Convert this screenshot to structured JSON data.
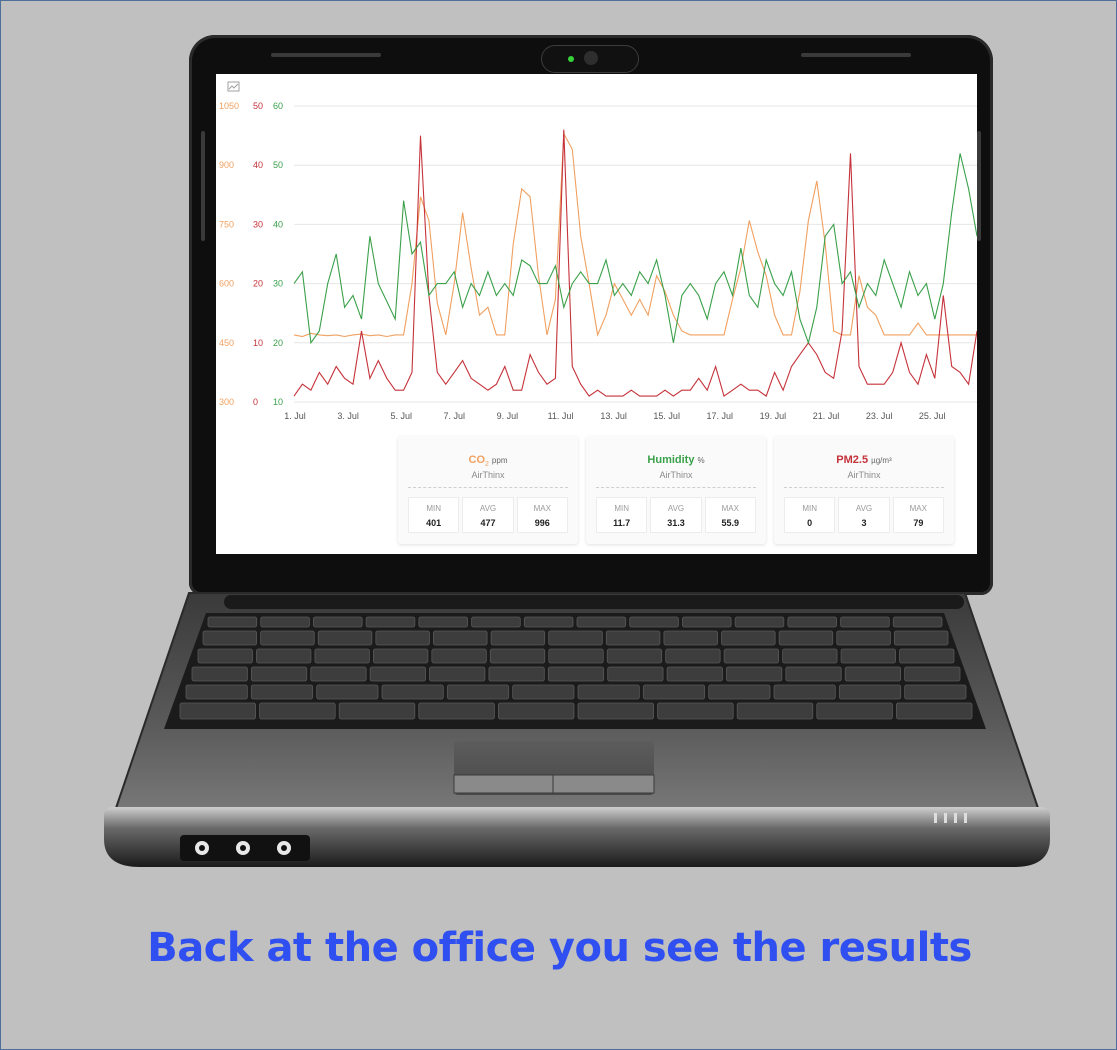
{
  "headline": "Back at the office you see the results",
  "chart_data": {
    "type": "line",
    "x_labels": [
      "1. Jul",
      "3. Jul",
      "5. Jul",
      "7. Jul",
      "9. Jul",
      "11. Jul",
      "13. Jul",
      "15. Jul",
      "17. Jul",
      "19. Jul",
      "21. Jul",
      "23. Jul",
      "25. Jul"
    ],
    "axes": [
      {
        "name": "co2",
        "color": "#f0a060",
        "ticks": [
          1050,
          900,
          750,
          600,
          450,
          300
        ]
      },
      {
        "name": "pm25",
        "color": "#c5323a",
        "ticks": [
          50,
          40,
          30,
          20,
          10,
          0
        ]
      },
      {
        "name": "humidity",
        "color": "#3aa04a",
        "ticks": [
          60,
          50,
          40,
          30,
          20,
          10
        ]
      }
    ],
    "series": [
      {
        "color": "#f0a060",
        "values": [
          470,
          466,
          474,
          470,
          468,
          470,
          466,
          470,
          472,
          468,
          470,
          466,
          470,
          470,
          600,
          820,
          760,
          550,
          470,
          600,
          780,
          640,
          520,
          540,
          470,
          470,
          700,
          840,
          820,
          620,
          470,
          560,
          980,
          940,
          720,
          600,
          470,
          520,
          600,
          560,
          520,
          560,
          520,
          620,
          580,
          520,
          480,
          470,
          470,
          470,
          470,
          470,
          560,
          640,
          760,
          680,
          620,
          520,
          470,
          470,
          580,
          760,
          860,
          700,
          480,
          470,
          470,
          620,
          540,
          520,
          470,
          470,
          470,
          470,
          500,
          470,
          470,
          470,
          470,
          470,
          470,
          470
        ]
      },
      {
        "color": "#c5323a",
        "values": [
          1,
          3,
          2,
          5,
          3,
          6,
          4,
          3,
          12,
          4,
          7,
          4,
          2,
          2,
          5,
          45,
          18,
          5,
          3,
          5,
          7,
          4,
          3,
          2,
          3,
          6,
          2,
          2,
          8,
          5,
          3,
          4,
          46,
          6,
          3,
          1,
          2,
          1,
          1,
          1,
          2,
          1,
          1,
          1,
          2,
          1,
          2,
          2,
          4,
          2,
          6,
          1,
          2,
          3,
          2,
          2,
          1,
          5,
          2,
          6,
          8,
          10,
          8,
          5,
          4,
          12,
          42,
          6,
          3,
          3,
          3,
          5,
          10,
          5,
          3,
          8,
          4,
          18,
          6,
          5,
          3,
          12
        ]
      },
      {
        "color": "#3aa04a",
        "values": [
          30,
          32,
          20,
          22,
          30,
          35,
          26,
          28,
          24,
          38,
          30,
          27,
          24,
          44,
          35,
          37,
          28,
          30,
          30,
          32,
          26,
          30,
          28,
          32,
          28,
          30,
          28,
          34,
          33,
          30,
          30,
          33,
          26,
          30,
          32,
          30,
          30,
          34,
          28,
          30,
          28,
          32,
          30,
          34,
          28,
          20,
          28,
          30,
          28,
          24,
          30,
          32,
          28,
          36,
          28,
          26,
          34,
          30,
          28,
          32,
          24,
          20,
          26,
          38,
          40,
          30,
          32,
          26,
          30,
          28,
          34,
          30,
          26,
          32,
          28,
          30,
          24,
          30,
          42,
          52,
          46,
          38
        ]
      }
    ]
  },
  "cards": [
    {
      "title": "CO",
      "sub": "2",
      "unit": "ppm",
      "source": "AirThinx",
      "color": "#f0a060",
      "stats": [
        {
          "label": "MIN",
          "value": "401"
        },
        {
          "label": "AVG",
          "value": "477"
        },
        {
          "label": "MAX",
          "value": "996"
        }
      ]
    },
    {
      "title": "Humidity",
      "sub": "",
      "unit": "%",
      "source": "AirThinx",
      "color": "#3aa04a",
      "stats": [
        {
          "label": "MIN",
          "value": "11.7"
        },
        {
          "label": "AVG",
          "value": "31.3"
        },
        {
          "label": "MAX",
          "value": "55.9"
        }
      ]
    },
    {
      "title": "PM2.5",
      "sub": "",
      "unit": "µg/m³",
      "source": "AirThinx",
      "color": "#c5323a",
      "stats": [
        {
          "label": "MIN",
          "value": "0"
        },
        {
          "label": "AVG",
          "value": "3"
        },
        {
          "label": "MAX",
          "value": "79"
        }
      ]
    }
  ]
}
